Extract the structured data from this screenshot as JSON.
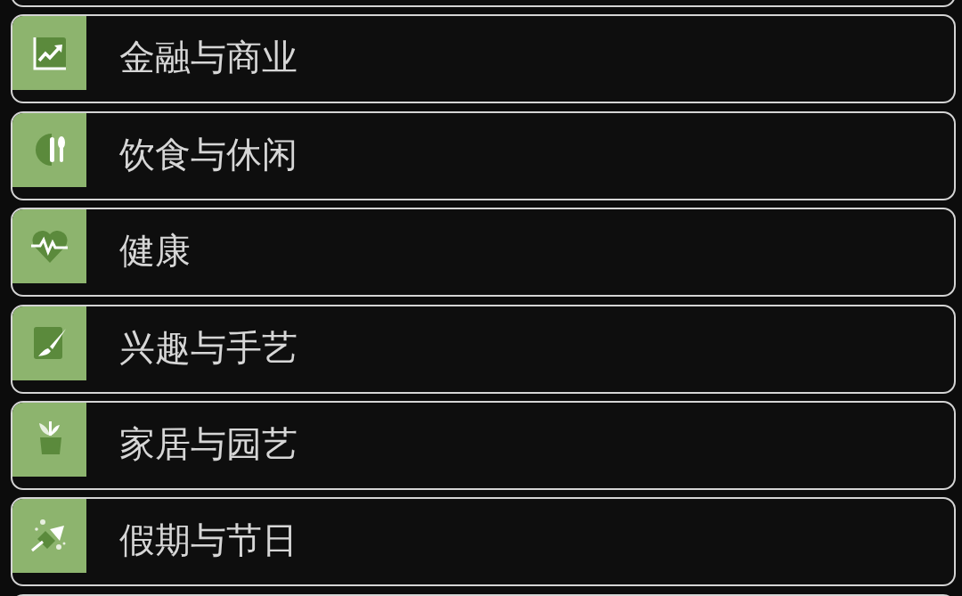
{
  "more_above": true,
  "categories": [
    {
      "label": "金融与商业",
      "kind": "chart"
    },
    {
      "label": "饮食与休闲",
      "kind": "dining"
    },
    {
      "label": "健康",
      "kind": "health"
    },
    {
      "label": "兴趣与手艺",
      "kind": "craft"
    },
    {
      "label": "家居与园艺",
      "kind": "plant"
    },
    {
      "label": "假期与节日",
      "kind": "party"
    }
  ],
  "more_below": true
}
